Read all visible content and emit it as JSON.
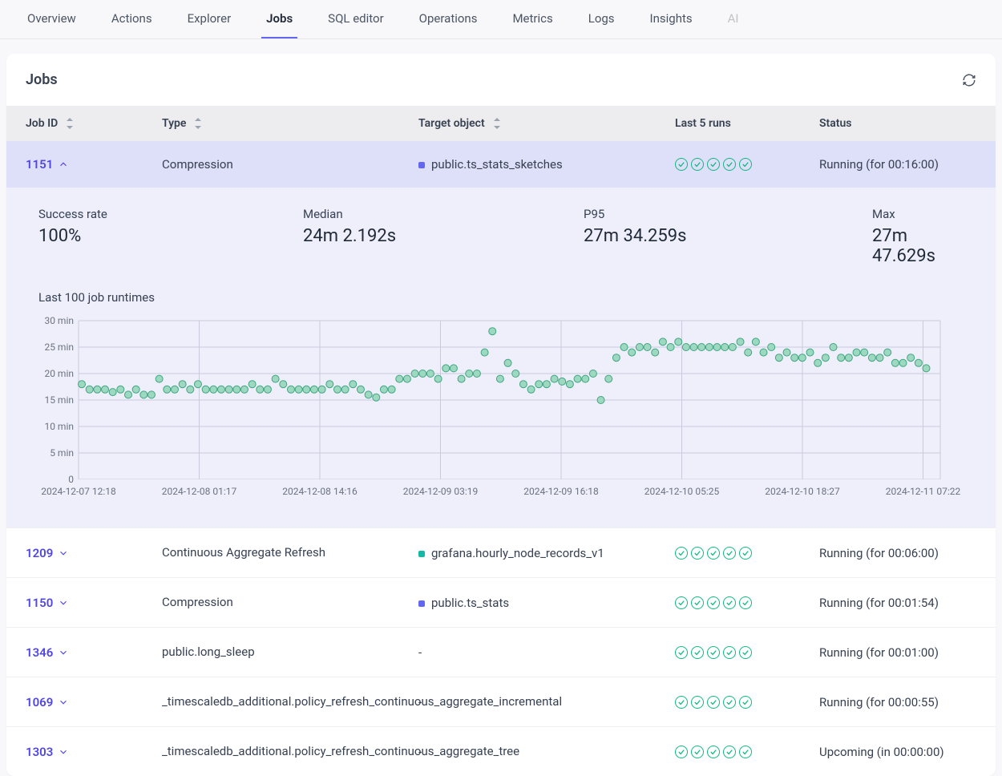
{
  "tabs": [
    {
      "label": "Overview"
    },
    {
      "label": "Actions"
    },
    {
      "label": "Explorer"
    },
    {
      "label": "Jobs",
      "active": true
    },
    {
      "label": "SQL editor"
    },
    {
      "label": "Operations"
    },
    {
      "label": "Metrics"
    },
    {
      "label": "Logs"
    },
    {
      "label": "Insights"
    },
    {
      "label": "AI",
      "disabled": true
    }
  ],
  "page_title": "Jobs",
  "columns": {
    "job_id": "Job ID",
    "type": "Type",
    "target": "Target object",
    "last5": "Last 5 runs",
    "status": "Status"
  },
  "selected_job": {
    "id": "1151",
    "type": "Compression",
    "target": "public.ts_stats_sketches",
    "target_color": "#6366f1",
    "status": "Running (for 00:16:00)",
    "stats": {
      "success_rate_label": "Success rate",
      "success_rate": "100%",
      "median_label": "Median",
      "median": "24m 2.192s",
      "p95_label": "P95",
      "p95": "27m 34.259s",
      "max_label": "Max",
      "max": "27m 47.629s"
    }
  },
  "jobs": [
    {
      "id": "1209",
      "type": "Continuous Aggregate Refresh",
      "target": "grafana.hourly_node_records_v1",
      "target_color": "#14b8a6",
      "status": "Running (for 00:06:00)"
    },
    {
      "id": "1150",
      "type": "Compression",
      "target": "public.ts_stats",
      "target_color": "#6366f1",
      "status": "Running (for 00:01:54)"
    },
    {
      "id": "1346",
      "type": "public.long_sleep",
      "target": "-",
      "target_color": "",
      "status": "Running (for 00:01:00)"
    },
    {
      "id": "1069",
      "type": "_timescaledb_additional.policy_refresh_continuous_aggregate_incremental",
      "target": "-",
      "target_color": "",
      "status": "Running (for 00:00:55)"
    },
    {
      "id": "1303",
      "type": "_timescaledb_additional.policy_refresh_continuous_aggregate_tree",
      "target": "-",
      "target_color": "",
      "status": "Upcoming (in 00:00:00)"
    }
  ],
  "chart_data": {
    "type": "scatter",
    "title": "Last 100 job runtimes",
    "ylabel_unit": "min",
    "ylim": [
      0,
      30
    ],
    "yticks": [
      0,
      5,
      10,
      15,
      20,
      25,
      30
    ],
    "xticks": [
      "2024-12-07 12:18",
      "2024-12-08 01:17",
      "2024-12-08 14:16",
      "2024-12-09 03:19",
      "2024-12-09 16:18",
      "2024-12-10 05:25",
      "2024-12-10 18:27",
      "2024-12-11 07:22"
    ],
    "values": [
      18,
      17,
      17,
      17,
      16.5,
      17,
      16,
      17,
      16,
      16,
      19,
      17,
      17,
      18,
      17,
      18,
      17,
      17,
      17,
      17,
      17,
      17,
      18,
      17,
      17,
      19,
      18,
      17,
      17,
      17,
      17,
      17,
      18,
      17,
      17,
      18,
      17,
      16,
      15.5,
      17,
      17,
      19,
      19,
      20,
      20,
      20,
      19,
      21,
      21,
      19,
      20,
      20,
      24,
      28,
      19,
      22,
      20,
      18,
      17,
      18,
      18,
      19,
      18.5,
      18,
      19,
      19,
      20,
      15,
      19,
      23,
      25,
      24,
      25,
      25,
      24,
      26,
      25,
      26,
      25,
      25,
      25,
      25,
      25,
      25,
      25,
      26,
      24,
      26,
      24,
      25,
      23,
      24,
      23,
      23,
      24,
      22,
      23,
      25,
      23,
      23,
      24,
      24,
      23,
      23,
      24,
      22,
      22,
      23,
      22,
      21
    ]
  }
}
